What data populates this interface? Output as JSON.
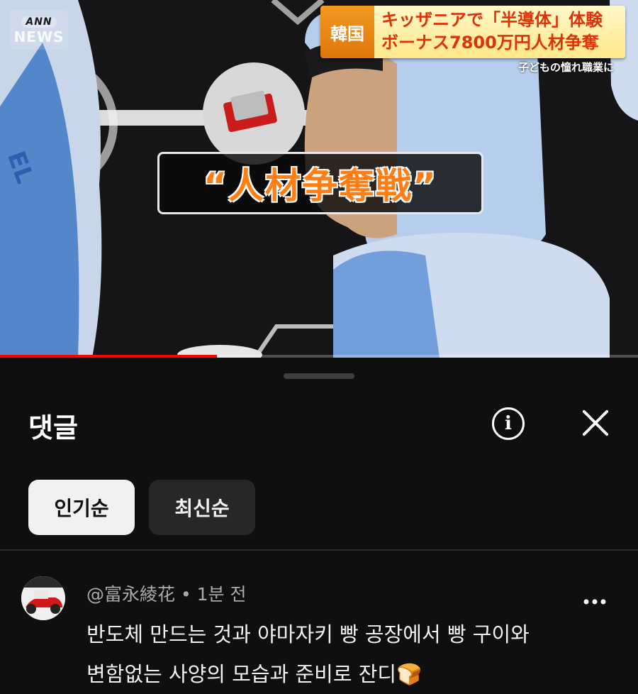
{
  "video": {
    "logo": {
      "top": "ANN",
      "bottom": "NEWS"
    },
    "headline": {
      "tag": "韓国",
      "line1": "キッザニアで「半導体」体験",
      "line2": "ボーナス7800万円人材争奪"
    },
    "subline": "子どもの憧れ職業に",
    "caption": "“人材争奪戦”",
    "progress": 0.34
  },
  "comments": {
    "title": "댓글",
    "info_icon": "info-icon",
    "close_icon": "close-icon",
    "sort_chips": [
      {
        "label": "인기순",
        "active": true
      },
      {
        "label": "최신순",
        "active": false
      }
    ],
    "items": [
      {
        "author": "@富永綾花",
        "separator": "•",
        "time": "1분 전",
        "lines": [
          "반도체 만드는 것과 야마자키 빵 공장에서 빵 구이와",
          "변함없는 사양의 모습과 준비로 잔디🍞"
        ],
        "more_icon": "more-vert-icon"
      }
    ]
  },
  "colors": {
    "background": "#0f0f0f",
    "chip_active": "#f1f1f1",
    "chip_inactive": "#272727",
    "caption_text": "#ff7d12",
    "headline_text": "#e0320a",
    "headline_tag": "#f29a1f"
  }
}
